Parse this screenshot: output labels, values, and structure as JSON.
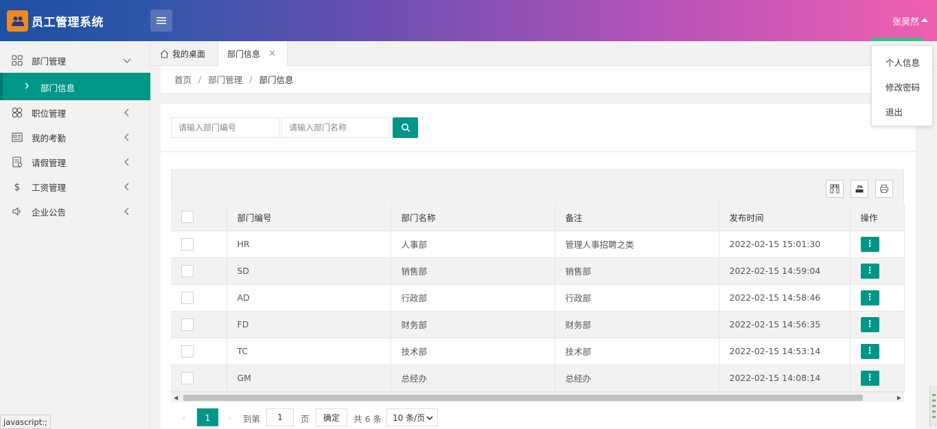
{
  "header": {
    "app_title": "员工管理系统",
    "user_name": "张昊然"
  },
  "user_menu": {
    "items": [
      "个人信息",
      "修改密码",
      "退出"
    ]
  },
  "sidebar": {
    "items": [
      {
        "label": "部门管理",
        "icon": "grid-icon",
        "expanded": true
      },
      {
        "label": "职位管理",
        "icon": "clover-icon"
      },
      {
        "label": "我的考勤",
        "icon": "attendance-icon"
      },
      {
        "label": "请假管理",
        "icon": "leave-icon"
      },
      {
        "label": "工资管理",
        "icon": "dollar-icon"
      },
      {
        "label": "企业公告",
        "icon": "speaker-icon"
      }
    ],
    "sub_item": {
      "label": "部门信息",
      "active": true
    }
  },
  "tabs": {
    "home": "我的桌面",
    "active": "部门信息"
  },
  "breadcrumb": {
    "items": [
      "首页",
      "部门管理",
      "部门信息"
    ]
  },
  "search": {
    "dept_no_placeholder": "请输入部门编号",
    "dept_name_placeholder": "请输入部门名称"
  },
  "table": {
    "columns": [
      "部门编号",
      "部门名称",
      "备注",
      "发布时间",
      "操作"
    ],
    "rows": [
      {
        "code": "HR",
        "name": "人事部",
        "remark": "管理人事招聘之类",
        "time": "2022-02-15 15:01:30"
      },
      {
        "code": "SD",
        "name": "销售部",
        "remark": "销售部",
        "time": "2022-02-15 14:59:04"
      },
      {
        "code": "AD",
        "name": "行政部",
        "remark": "行政部",
        "time": "2022-02-15 14:58:46"
      },
      {
        "code": "FD",
        "name": "财务部",
        "remark": "财务部",
        "time": "2022-02-15 14:56:35"
      },
      {
        "code": "TC",
        "name": "技术部",
        "remark": "技术部",
        "time": "2022-02-15 14:53:14"
      },
      {
        "code": "GM",
        "name": "总经办",
        "remark": "总经办",
        "time": "2022-02-15 14:08:14"
      }
    ],
    "op_button_glyph": "⋮"
  },
  "pager": {
    "current": "1",
    "goto_label": "到第",
    "goto_value": "1",
    "page_unit": "页",
    "confirm": "确定",
    "total": "共 6 条",
    "page_size": "10 条/页"
  },
  "status_tip": "javascript:;",
  "colors": {
    "accent": "#009688",
    "header_start": "#1e4fa3",
    "header_end": "#f060b0",
    "logo": "#f08a1c"
  }
}
